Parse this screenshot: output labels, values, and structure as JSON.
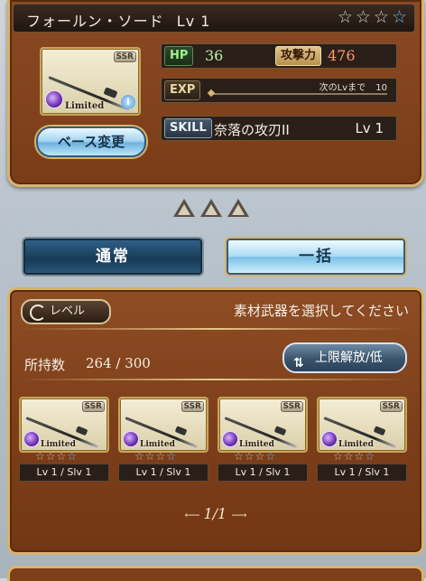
{
  "weapon": {
    "name": "フォールン・ソード",
    "level": "Lv 1",
    "rarity": "SSR",
    "badge": "Limited",
    "stars_filled": 0,
    "stars_total": 4
  },
  "stats": {
    "hp_label": "HP",
    "hp_value": "36",
    "atk_label": "攻撃力",
    "atk_value": "476",
    "exp_label": "EXP",
    "next_label": "次のLvまで",
    "next_value": "10",
    "skill_label": "SKILL",
    "skill_name": "奈落の攻刃II",
    "skill_level": "Lv 1"
  },
  "buttons": {
    "base_change": "ベース変更",
    "tab_normal": "通常",
    "tab_bulk": "一括",
    "level_sort": "レベル",
    "limit_release": "上限解放/低"
  },
  "material": {
    "instruction": "素材武器を選択してください",
    "owned_label": "所持数",
    "owned_value": "264 / 300",
    "cards": [
      {
        "rarity": "SSR",
        "badge": "Limited",
        "level": "Lv 1 / Slv 1"
      },
      {
        "rarity": "SSR",
        "badge": "Limited",
        "level": "Lv 1 / Slv 1"
      },
      {
        "rarity": "SSR",
        "badge": "Limited",
        "level": "Lv 1 / Slv 1"
      },
      {
        "rarity": "SSR",
        "badge": "Limited",
        "level": "Lv 1 / Slv 1"
      }
    ],
    "page": "1/1"
  },
  "colors": {
    "frame_brown": "#7a3c18",
    "gold_border": "#d8b36a",
    "atk_value": "#ff9a66",
    "hp_value": "#b9f0a8"
  }
}
